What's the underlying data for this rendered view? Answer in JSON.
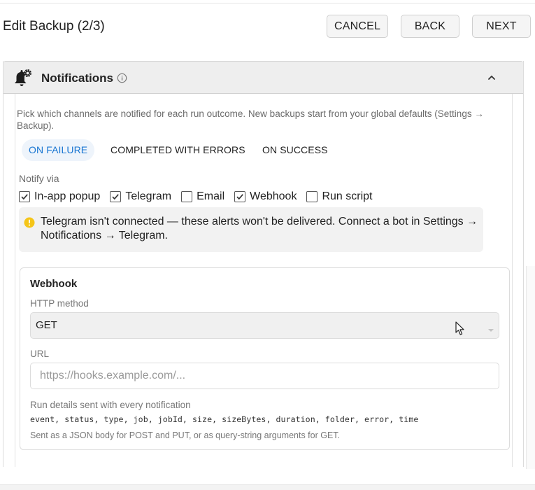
{
  "header": {
    "title": "Edit Backup (2/3)",
    "cancel_label": "CANCEL",
    "back_label": "BACK",
    "next_label": "NEXT"
  },
  "panel": {
    "title": "Notifications",
    "intro": "Pick which channels are notified for each run outcome. New backups start from your global defaults (Settings → Backup).",
    "tabs": [
      {
        "label": "ON FAILURE",
        "active": true
      },
      {
        "label": "COMPLETED WITH ERRORS",
        "active": false
      },
      {
        "label": "ON SUCCESS",
        "active": false
      }
    ],
    "notify_label": "Notify via",
    "channels": [
      {
        "label": "In-app popup",
        "checked": true
      },
      {
        "label": "Telegram",
        "checked": true
      },
      {
        "label": "Email",
        "checked": false
      },
      {
        "label": "Webhook",
        "checked": true
      },
      {
        "label": "Run script",
        "checked": false
      }
    ],
    "warning": "Telegram isn't connected — these alerts won't be delivered. Connect a bot in Settings → Notifications → Telegram."
  },
  "webhook": {
    "title": "Webhook",
    "method_label": "HTTP method",
    "method_value": "GET",
    "url_label": "URL",
    "url_value": "",
    "url_placeholder": "https://hooks.example.com/...",
    "details_label": "Run details sent with every notification",
    "fields": "event, status, type, job, jobId, size, sizeBytes, duration, folder, error, time",
    "body_note": "Sent as a JSON body for POST and PUT, or as query-string arguments for GET."
  },
  "colors": {
    "accent": "#1976d2",
    "warning": "#f5c518",
    "header_bg": "#eeeeee"
  },
  "icons": [
    "bell-gear-icon",
    "info-icon",
    "chevron-up-icon",
    "warning-icon",
    "dropdown-arrow-icon",
    "mouse-cursor-icon"
  ]
}
